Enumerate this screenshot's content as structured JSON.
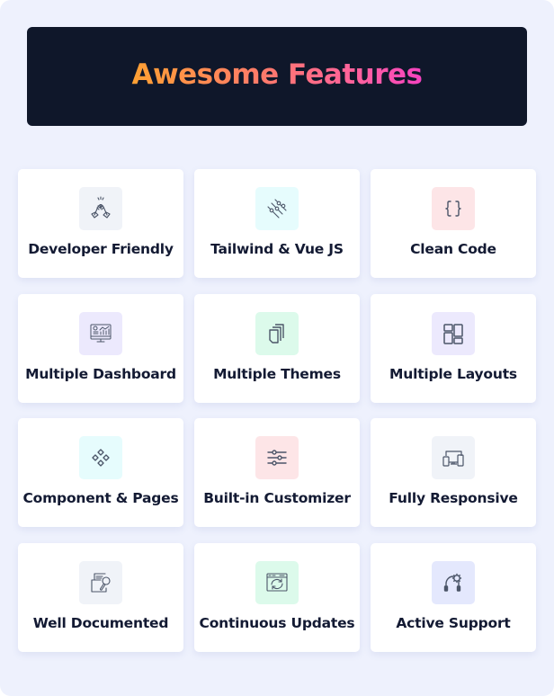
{
  "banner": {
    "title": "Awesome Features"
  },
  "features": [
    {
      "label": "Developer Friendly",
      "icon": "high-five-icon",
      "icon_bg": "#f0f3f8"
    },
    {
      "label": "Tailwind & Vue JS",
      "icon": "sliders-diagonal-icon",
      "icon_bg": "#e6fcfd"
    },
    {
      "label": "Clean Code",
      "icon": "curly-braces-icon",
      "icon_bg": "#fde5e7"
    },
    {
      "label": "Multiple Dashboard",
      "icon": "monitor-dashboard-icon",
      "icon_bg": "#ece9fd"
    },
    {
      "label": "Multiple Themes",
      "icon": "stacked-pages-icon",
      "icon_bg": "#dcfaeb"
    },
    {
      "label": "Multiple Layouts",
      "icon": "layout-grid-icon",
      "icon_bg": "#ece9fd"
    },
    {
      "label": "Component & Pages",
      "icon": "components-diamond-icon",
      "icon_bg": "#e6fcfd"
    },
    {
      "label": "Built-in Customizer",
      "icon": "sliders-horizontal-icon",
      "icon_bg": "#fde5e7"
    },
    {
      "label": "Fully Responsive",
      "icon": "responsive-devices-icon",
      "icon_bg": "#f0f3f8"
    },
    {
      "label": "Well Documented",
      "icon": "document-search-icon",
      "icon_bg": "#f0f3f8"
    },
    {
      "label": "Continuous Updates",
      "icon": "browser-refresh-icon",
      "icon_bg": "#dcfaeb"
    },
    {
      "label": "Active Support",
      "icon": "headset-gear-icon",
      "icon_bg": "#e4e8fd"
    }
  ],
  "colors": {
    "page_bg": "#eef1fd",
    "banner_bg": "#0f172a",
    "title_gradient_start": "#ffa133",
    "title_gradient_end": "#f542c0",
    "label_text": "#131a33",
    "icon_stroke": "#4b5568"
  }
}
